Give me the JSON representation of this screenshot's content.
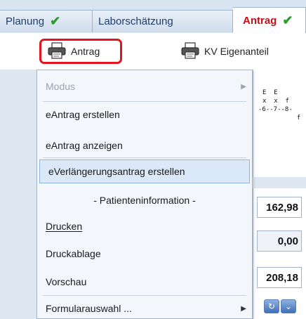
{
  "tabs": [
    {
      "label": "Planung",
      "check": "✔"
    },
    {
      "label": "Laborschätzung",
      "check": ""
    },
    {
      "label": "Antrag",
      "check": "✔"
    }
  ],
  "toolbar": {
    "antrag_label": "Antrag",
    "kv_label": "KV Eigenanteil"
  },
  "background": {
    "code_lines": [
      "E  E",
      "x  x  f",
      "-6--7--8-",
      "         f"
    ],
    "values": [
      "162,98",
      "0,00",
      "208,18"
    ]
  },
  "menu": {
    "items": [
      {
        "label": "Modus",
        "disabled": true,
        "submenu": true
      },
      {
        "label": "eAntrag erstellen"
      },
      {
        "label": "eAntrag anzeigen"
      },
      {
        "label": "eVerlängerungsantrag erstellen",
        "highlighted": true
      },
      {
        "label": "- Patienteninformation -",
        "header": true
      },
      {
        "label": "Drucken",
        "mnemonic": "D"
      },
      {
        "label": "Druckablage",
        "mnemonic": "a"
      },
      {
        "label": "Vorschau",
        "mnemonic": "V"
      },
      {
        "label": "Formularauswahl ...",
        "submenu": true
      }
    ]
  },
  "icons": {
    "printer": "printer-icon",
    "check": "check-icon",
    "submenu_arrow": "submenu-arrow-icon"
  },
  "colors": {
    "accent_red": "#e2141e",
    "check_green": "#2a9d2a",
    "highlight": "#dbe8f7"
  }
}
